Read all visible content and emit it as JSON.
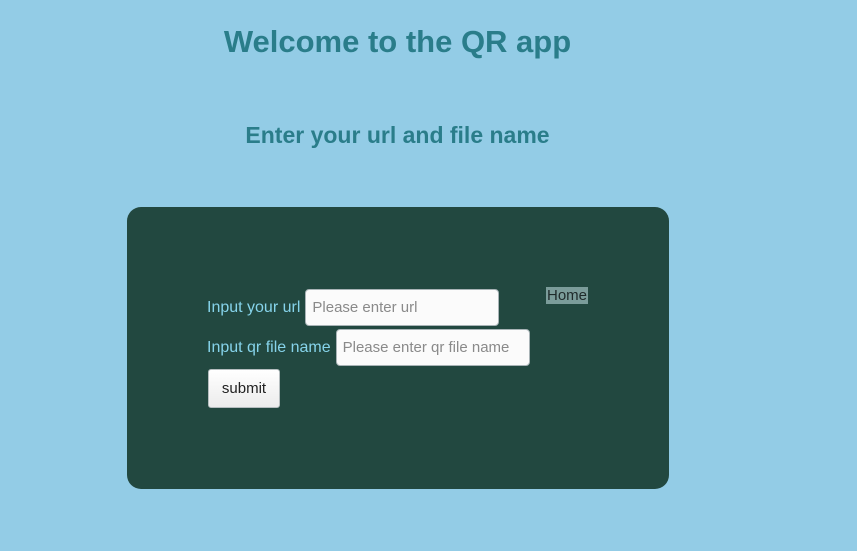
{
  "header": {
    "title": "Welcome to the QR app",
    "subtitle": "Enter your url and file name"
  },
  "form": {
    "url": {
      "label": "Input your url",
      "value": "",
      "placeholder": "Please enter url"
    },
    "file_name": {
      "label": "Input qr file name",
      "value": "",
      "placeholder": "Please enter qr file name"
    },
    "submit_label": "submit",
    "home_link": "Home"
  },
  "colors": {
    "page_background": "#93cce6",
    "heading": "#2a7d8a",
    "card_background": "#224840",
    "label": "#86d3ea"
  }
}
